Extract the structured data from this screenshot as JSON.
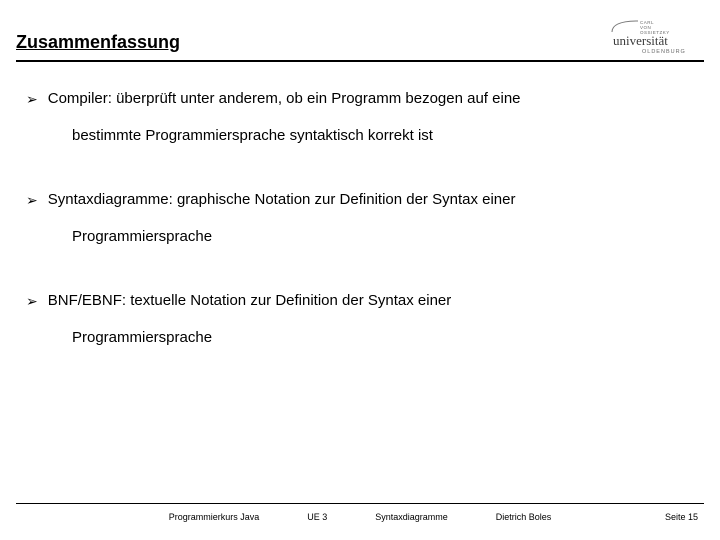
{
  "header": {
    "title": "Zusammenfassung",
    "logo_lines": [
      "CARL",
      "VON",
      "OSSIETZKY"
    ],
    "logo_word": "universität",
    "logo_sub": "OLDENBURG"
  },
  "bullets": [
    {
      "lead": "Compiler: überprüft unter anderem, ob ein Programm bezogen auf eine",
      "cont": "bestimmte Programmiersprache syntaktisch korrekt ist"
    },
    {
      "lead": "Syntaxdiagramme: graphische Notation zur Definition der Syntax einer",
      "cont": "Programmiersprache"
    },
    {
      "lead": "BNF/EBNF: textuelle Notation zur Definition der Syntax einer",
      "cont": "Programmiersprache"
    }
  ],
  "footer": {
    "course": "Programmierkurs Java",
    "unit": "UE 3",
    "topic": "Syntaxdiagramme",
    "author": "Dietrich Boles",
    "page": "Seite 15"
  }
}
